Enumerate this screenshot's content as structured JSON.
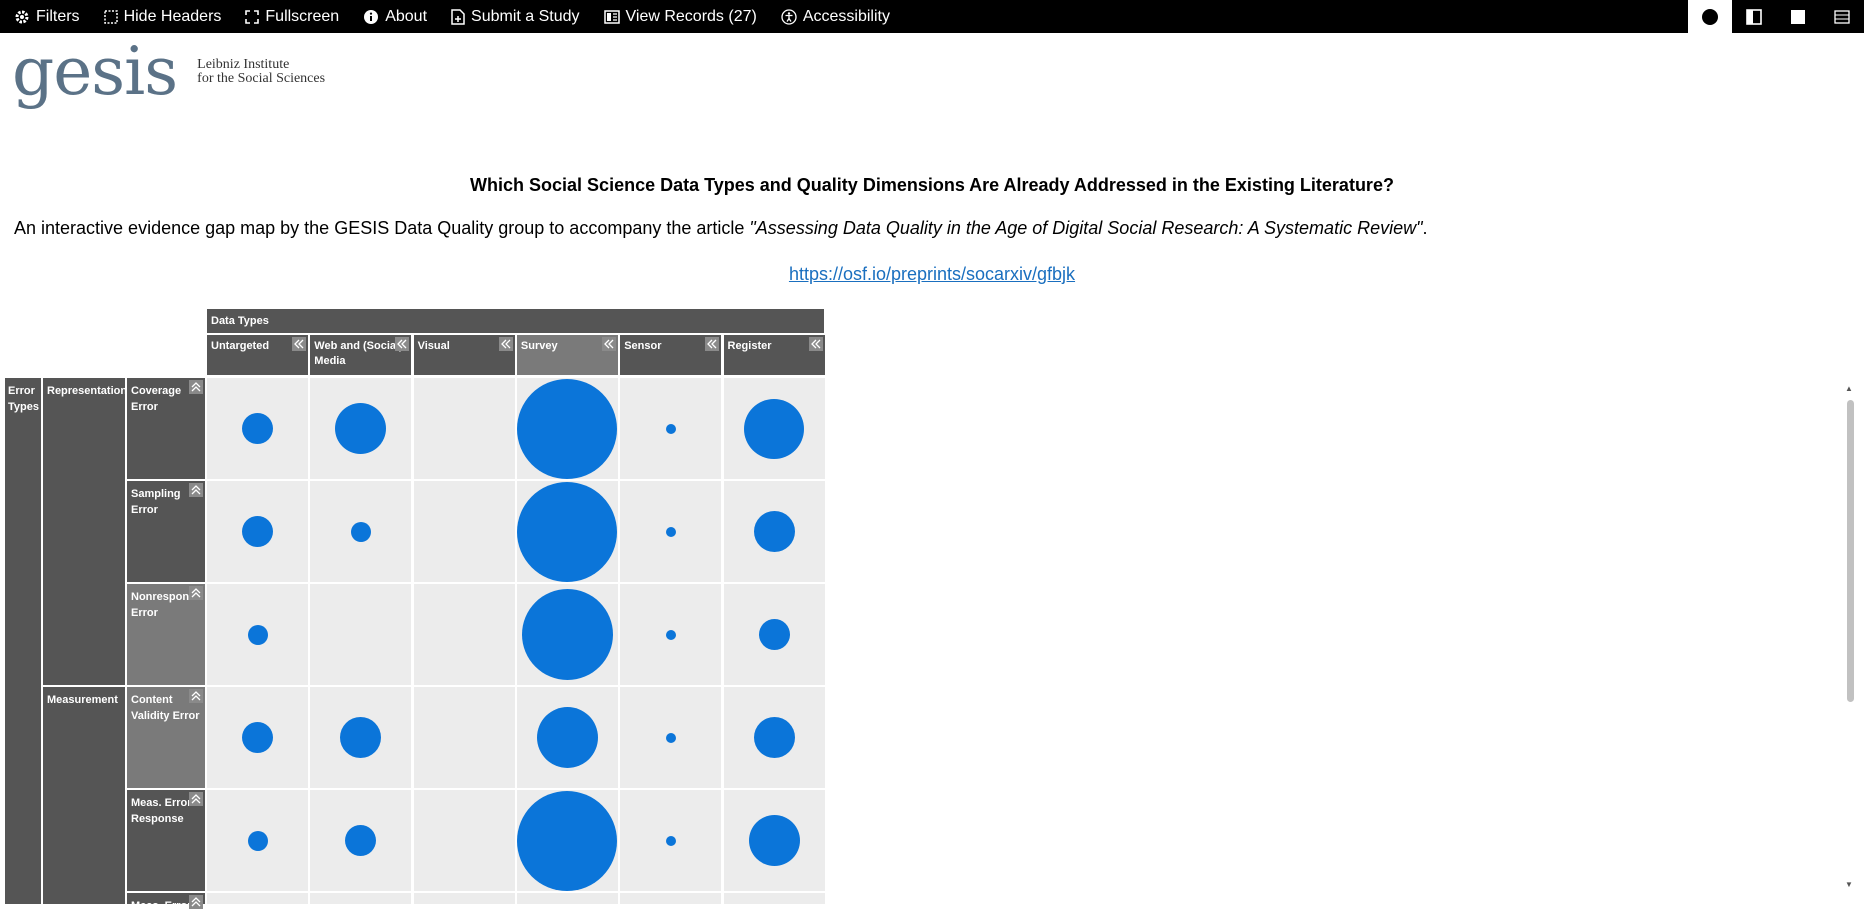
{
  "nav": {
    "filters": "Filters",
    "hide_headers": "Hide Headers",
    "fullscreen": "Fullscreen",
    "about": "About",
    "submit": "Submit a Study",
    "view_records": "View Records (27)",
    "accessibility": "Accessibility"
  },
  "logo": {
    "word": "gesis",
    "line1": "Leibniz Institute",
    "line2": "for the Social Sciences"
  },
  "title": "Which Social Science Data Types and Quality Dimensions Are Already Addressed in the Existing Literature?",
  "intro": {
    "prefix": "An interactive evidence gap map by the GESIS Data Quality group to accompany the article ",
    "article": "\"Assessing Data Quality in the Age of Digital Social Research: A Systematic Review\"",
    "suffix": "."
  },
  "link": "https://osf.io/preprints/socarxiv/gfbjk",
  "grid": {
    "data_types_label": "Data Types",
    "columns": [
      "Untargeted",
      "Web and (Social) Media",
      "Visual",
      "Survey",
      "Sensor",
      "Register"
    ],
    "error_types_label": "Error Types",
    "groups": [
      "Representation",
      "Measurement"
    ],
    "rows": [
      "Coverage Error",
      "Sampling Error",
      "Nonresponse Error",
      "Content Validity Error",
      "Meas. Error Response",
      "Meas. Error"
    ]
  },
  "colors": {
    "bubble": "#0b75d9",
    "header": "#555555",
    "cell": "#ececec"
  },
  "bubble_diameters_relative": [
    [
      0.31,
      0.51,
      0,
      1.0,
      0.1,
      0.6
    ],
    [
      0.31,
      0.2,
      0,
      1.0,
      0.1,
      0.41
    ],
    [
      0.2,
      0,
      0,
      0.91,
      0.1,
      0.31
    ],
    [
      0.31,
      0.41,
      0,
      0.61,
      0.1,
      0.41
    ],
    [
      0.2,
      0.31,
      0,
      1.0,
      0.1,
      0.51
    ],
    [
      0,
      0,
      0,
      0,
      0,
      0
    ]
  ]
}
